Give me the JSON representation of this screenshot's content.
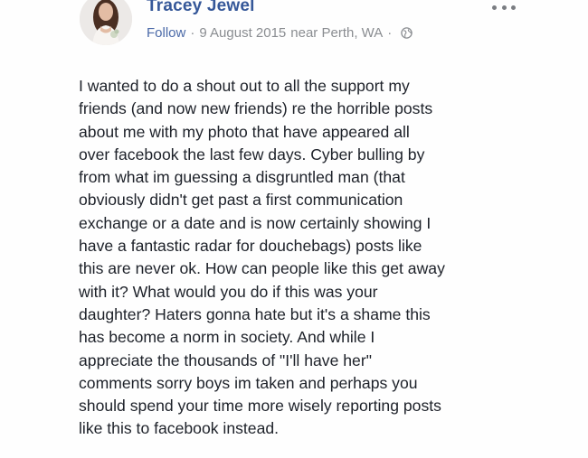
{
  "post": {
    "author": {
      "name": "Tracey Jewel",
      "avatar_icon": "profile-photo"
    },
    "meta": {
      "follow_label": "Follow",
      "separator": "·",
      "date": "9 August 2015",
      "location": "near Perth, WA",
      "privacy_icon": "globe-icon"
    },
    "more_options_icon": "more-horizontal-icon",
    "body_lines": [
      "I wanted to do a shout out to all the support my",
      "friends (and now new friends) re the horrible posts",
      "about me with my photo that have appeared all",
      "over facebook the last few days. Cyber bulling by",
      "from what im guessing a disgruntled man (that",
      "obviously didn't get past a first communication",
      "exchange or a date and is now certainly showing I",
      "have a fantastic radar for douchebags) posts like",
      "this are never ok. How can people like this get away",
      "with it? What would you do if this was your",
      "daughter? Haters gonna hate but it's a shame this",
      "has become a norm in society. And while I",
      "appreciate the thousands of \"I'll have her\"",
      "comments sorry boys im taken and perhaps you",
      "should spend your time more wisely reporting posts",
      "like this to facebook instead."
    ]
  },
  "colors": {
    "name": "#365899",
    "meta": "#8a8d91",
    "body_text": "#1d2129",
    "background": "#ffffff"
  }
}
